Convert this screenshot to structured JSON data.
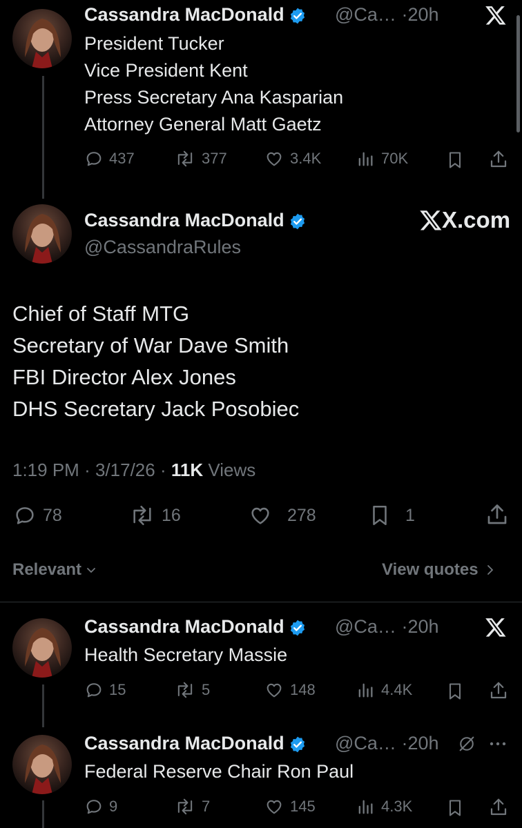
{
  "tweets": [
    {
      "name": "Cassandra MacDonald",
      "handle": "@Ca…",
      "dot": "·",
      "time": "20h",
      "lines": [
        "President Tucker",
        "Vice President Kent",
        "Press Secretary Ana Kasparian",
        "Attorney General Matt Gaetz"
      ],
      "replies": "437",
      "reposts": "377",
      "likes": "3.4K",
      "views": "70K"
    },
    {
      "name": "Cassandra MacDonald",
      "handle": "@Ca…",
      "dot": "·",
      "time": "20h",
      "lines": [
        "Health Secretary Massie"
      ],
      "replies": "15",
      "reposts": "5",
      "likes": "148",
      "views": "4.4K"
    },
    {
      "name": "Cassandra MacDonald",
      "handle": "@Ca…",
      "dot": "·",
      "time": "20h",
      "lines": [
        "Federal Reserve Chair Ron Paul"
      ],
      "replies": "9",
      "reposts": "7",
      "likes": "145",
      "views": "4.3K"
    }
  ],
  "main_tweet": {
    "name": "Cassandra MacDonald",
    "handle": "@CassandraRules",
    "brand": "X.com",
    "lines": [
      "Chief of Staff MTG",
      "Secretary of War Dave Smith",
      "FBI Director Alex Jones",
      "DHS Secretary Jack Posobiec"
    ],
    "time": "1:19 PM",
    "date": "3/17/26",
    "views_count": "11K",
    "views_label": "Views",
    "replies": "78",
    "reposts": "16",
    "likes": "278",
    "bookmarks": "1"
  },
  "sort": {
    "label": "Relevant",
    "quotes_label": "View quotes"
  },
  "colors": {
    "background": "#000000",
    "text": "#e7e9ea",
    "muted": "#71767b",
    "verified": "#1d9bf0"
  }
}
